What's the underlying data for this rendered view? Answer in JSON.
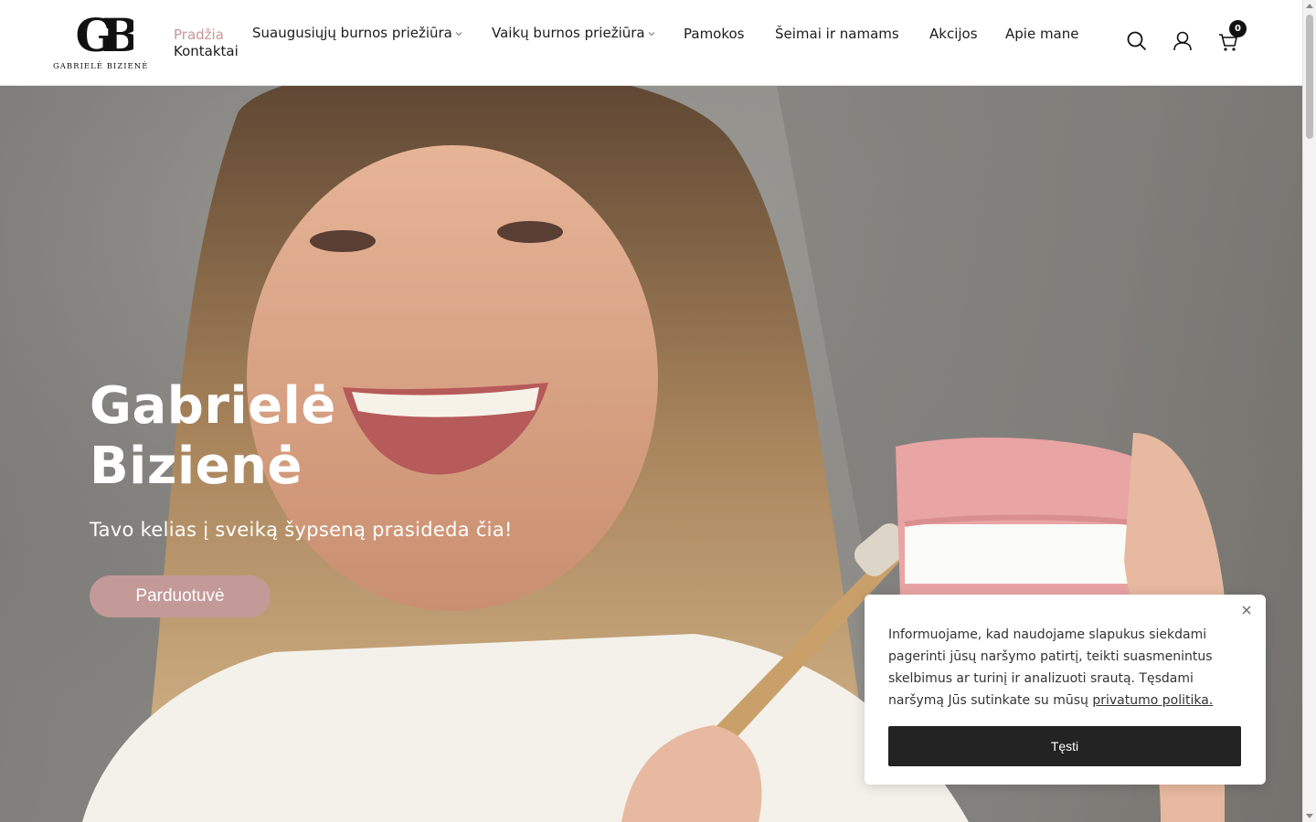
{
  "header": {
    "logo": {
      "monogram": "GB",
      "name": "GABRIELĖ BIZIENĖ"
    },
    "nav": [
      {
        "label": "Pradžia",
        "active": true,
        "dropdown": false
      },
      {
        "label": "Suaugusiųjų burnos priežiūra",
        "active": false,
        "dropdown": true
      },
      {
        "label": "Vaikų burnos priežiūra",
        "active": false,
        "dropdown": true
      },
      {
        "label": "Pamokos",
        "active": false,
        "dropdown": false
      },
      {
        "label": "Šeimai ir namams",
        "active": false,
        "dropdown": false
      },
      {
        "label": "Akcijos",
        "active": false,
        "dropdown": false
      },
      {
        "label": "Apie mane",
        "active": false,
        "dropdown": false
      },
      {
        "label": "Kontaktai",
        "active": false,
        "dropdown": false
      }
    ],
    "icons": [
      "search-icon",
      "account-icon",
      "cart-icon"
    ],
    "cart_count": "0"
  },
  "hero": {
    "title_line1": "Gabrielė",
    "title_line2": "Bizienė",
    "subtitle": "Tavo kelias į sveiką šypseną prasideda čia!",
    "button_label": "Parduotuvė"
  },
  "cookie": {
    "text": "Informuojame, kad naudojame slapukus siekdami pagerinti jūsų naršymo patirtį, teikti suasmenintus skelbimus ar turinį ir analizuoti srautą. Tęsdami naršymą Jūs sutinkate su mūsų ",
    "link_label": "privatumo politika.",
    "button_label": "Tęsti"
  },
  "colors": {
    "accent": "#c49795",
    "button_dark": "#232323",
    "text": "#1c1c1c"
  }
}
